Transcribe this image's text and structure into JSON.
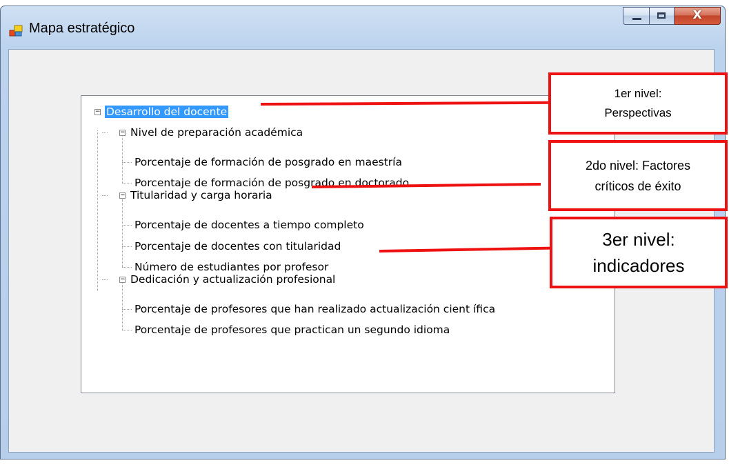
{
  "window": {
    "title": "Mapa estratégico",
    "close_glyph": "X"
  },
  "tree": {
    "root": {
      "label": "Desarrollo del docente",
      "expander": "−"
    },
    "groups": [
      {
        "label": "Nivel de preparación académica",
        "expander": "−",
        "items": [
          "Porcentaje de formación de posgrado en maestría",
          "Porcentaje de formación de posgrado en doctorado"
        ]
      },
      {
        "label": "Titularidad y carga horaria",
        "expander": "−",
        "items": [
          "Porcentaje de docentes a tiempo completo",
          "Porcentaje de docentes con titularidad",
          "Número de estudiantes por profesor"
        ]
      },
      {
        "label": "Dedicación y actualización profesional",
        "expander": "−",
        "items": [
          "Porcentaje de profesores que han realizado actualización cient ífica",
          "Porcentaje de profesores que practican un segundo idioma"
        ]
      }
    ]
  },
  "annotations": [
    {
      "line1": "1er nivel:",
      "line2": "Perspectivas"
    },
    {
      "line1": "2do nivel: Factores",
      "line2": "críticos de éxito"
    },
    {
      "line1": "3er nivel:",
      "line2": "indicadores"
    }
  ],
  "colors": {
    "annotation_red": "#ee1111",
    "selection_blue": "#3399ff"
  }
}
